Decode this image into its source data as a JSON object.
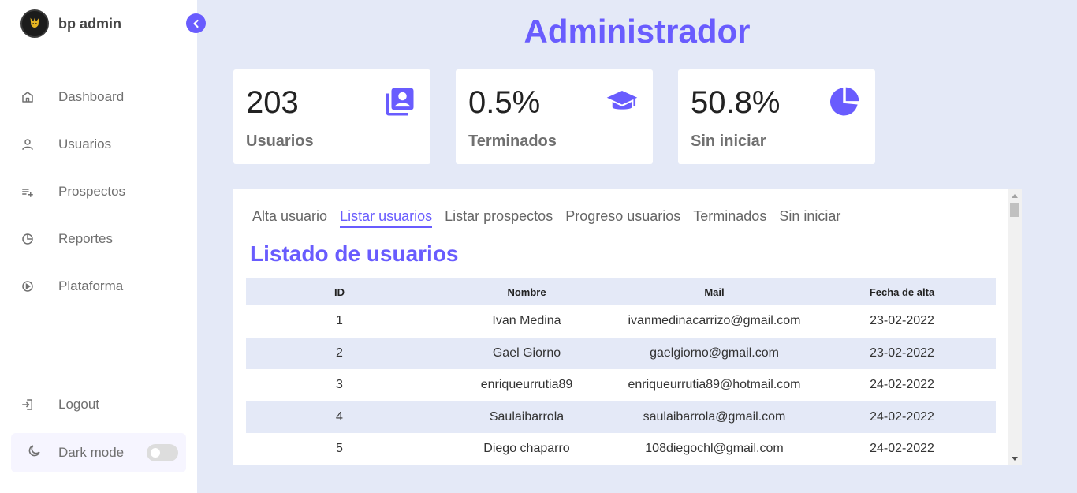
{
  "brand": {
    "name": "bp admin"
  },
  "sidebar": {
    "items": [
      {
        "label": "Dashboard",
        "icon": "home-icon"
      },
      {
        "label": "Usuarios",
        "icon": "user-icon"
      },
      {
        "label": "Prospectos",
        "icon": "playlist-add-icon"
      },
      {
        "label": "Reportes",
        "icon": "pie-chart-icon"
      },
      {
        "label": "Plataforma",
        "icon": "play-circle-icon"
      }
    ],
    "logout": "Logout",
    "darkmode": "Dark mode",
    "darkmode_on": false
  },
  "header": {
    "title": "Administrador"
  },
  "cards": [
    {
      "value": "203",
      "label": "Usuarios",
      "icon": "user-list-icon"
    },
    {
      "value": "0.5%",
      "label": "Terminados",
      "icon": "graduation-cap-icon"
    },
    {
      "value": "50.8%",
      "label": "Sin iniciar",
      "icon": "pie-chart-icon"
    }
  ],
  "tabs": [
    "Alta usuario",
    "Listar usuarios",
    "Listar prospectos",
    "Progreso usuarios",
    "Terminados",
    "Sin iniciar"
  ],
  "active_tab": "Listar usuarios",
  "panel": {
    "title": "Listado de usuarios"
  },
  "table": {
    "headers": [
      "ID",
      "Nombre",
      "Mail",
      "Fecha de alta"
    ],
    "rows": [
      [
        "1",
        "Ivan Medina",
        "ivanmedinacarrizo@gmail.com",
        "23-02-2022"
      ],
      [
        "2",
        "Gael Giorno",
        "gaelgiorno@gmail.com",
        "23-02-2022"
      ],
      [
        "3",
        "enriqueurrutia89",
        "enriqueurrutia89@hotmail.com",
        "24-02-2022"
      ],
      [
        "4",
        "Saulaibarrola",
        "saulaibarrola@gmail.com",
        "24-02-2022"
      ],
      [
        "5",
        "Diego chaparro",
        "108diegochl@gmail.com",
        "24-02-2022"
      ]
    ]
  },
  "colors": {
    "accent": "#695cfe",
    "background": "#e4e9f7",
    "sidebar": "#ffffff"
  }
}
